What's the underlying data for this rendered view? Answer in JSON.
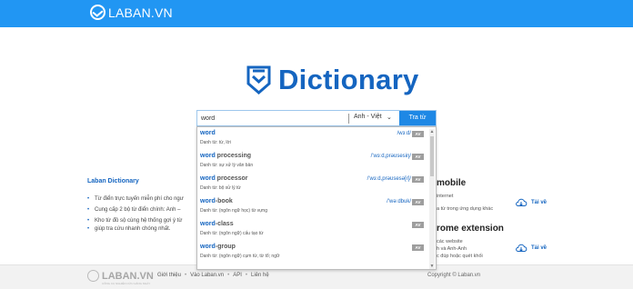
{
  "header": {
    "logo_text": "LABAN.VN",
    "brand_color": "#2196f3"
  },
  "brand": {
    "title": "Dictionary",
    "icon": "shield-icon",
    "color": "#1565c0"
  },
  "search": {
    "value": "word",
    "language": "Anh - Việt",
    "button_label": "Tra từ"
  },
  "suggestions": [
    {
      "word_bold": "word",
      "word_rest": "",
      "meaning": "Danh từ: từ, lời",
      "phonetic": "/wɜːd/",
      "badge": "AV"
    },
    {
      "word_bold": "word",
      "word_rest": " processing",
      "meaning": "Danh từ: sự xử lý văn bản",
      "phonetic": "/'wɜːd,prəʊsesiŋ/",
      "badge": "AV"
    },
    {
      "word_bold": "word",
      "word_rest": " processor",
      "meaning": "Danh từ: bộ xử lý từ",
      "phonetic": "/'wɜːd,prəʊsesə[r]/",
      "badge": "AV"
    },
    {
      "word_bold": "word",
      "word_rest": "-book",
      "meaning": "Danh từ: (ngôn ngữ học) từ vựng",
      "phonetic": "/'wəːdbuk/",
      "badge": "AV"
    },
    {
      "word_bold": "word",
      "word_rest": "-class",
      "meaning": "Danh từ: (ngôn ngữ) cấu tạo từ",
      "phonetic": "",
      "badge": "AV"
    },
    {
      "word_bold": "word",
      "word_rest": "-group",
      "meaning": "Danh từ: (ngôn ngữ) cụm từ, từ tổ; ngữ",
      "phonetic": "",
      "badge": "AV"
    }
  ],
  "about": {
    "title": "Laban Dictionary",
    "bullets": [
      "Từ điển trực tuyến miễn phí cho ngư",
      "Cung cấp 2 bộ từ điển chính: Anh –",
      "Kho từ đồ sộ cùng hệ thống gợi ý từ",
      "giúp tra cứu nhanh chóng nhất."
    ]
  },
  "mobile": {
    "title": "mobile",
    "desc": "internet",
    "desc2": "a từ trong ứng dụng khác",
    "download_label": "Tải về"
  },
  "chrome": {
    "title": "rome extension",
    "desc1": "các website",
    "desc2": "h và Anh-Anh",
    "desc3": "c đúp hoặc quét khối",
    "download_label": "Tải về"
  },
  "footer": {
    "logo_text": "LABAN.VN",
    "logo_sub": "CÔNG CỤ NGHIÊN CỨU HẰNG NGÀY",
    "links": [
      "Giới thiệu",
      "Vào Laban.vn",
      "API",
      "Liên hệ"
    ],
    "copyright": "Copyright © Laban.vn"
  }
}
